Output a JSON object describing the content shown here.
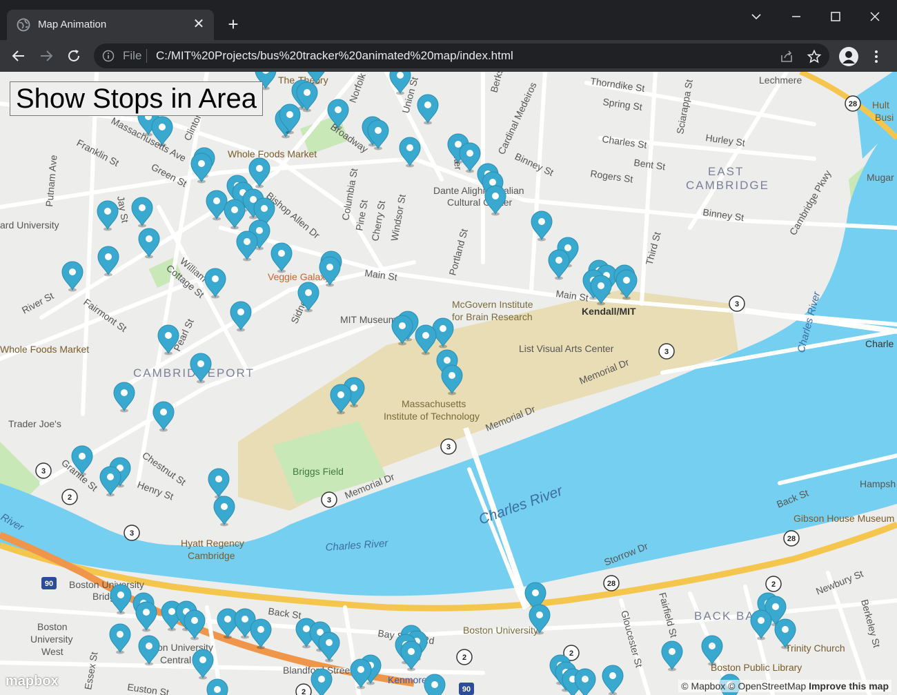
{
  "browser": {
    "tab_title": "Map Animation",
    "address_scheme": "File",
    "address_url": "C:/MIT%20Projects/bus%20tracker%20animated%20map/index.html"
  },
  "page": {
    "button_label": "Show Stops in Area"
  },
  "map": {
    "attribution_mapbox": "© Mapbox",
    "attribution_osm": "© OpenStreetMap",
    "attribution_improve": "Improve this map",
    "logo": "mapbox",
    "colors": {
      "water": "#75cff0",
      "land": "#ededeb",
      "campus": "#e8ddb5",
      "park": "#c9e8b8",
      "highway": "#f5c64d",
      "marker": "#3aa9cf"
    },
    "labels": {
      "lechmere": "Lechmere",
      "thorndike": "Thorndike St",
      "spring": "Spring St",
      "charles_st": "Charles St",
      "hurley": "Hurley St",
      "bent": "Bent St",
      "rogers": "Rogers St",
      "east_cambridge_1": "EAST",
      "east_cambridge_2": "CAMBRIDGE",
      "binney": "Binney St",
      "binney2": "Binney St",
      "whole_foods_1": "Whole Foods Market",
      "whole_foods_2": "Whole Foods Market",
      "franklin": "Franklin St",
      "green": "Green St",
      "putnam": "Putnam Ave",
      "harvard_univ": "ard University",
      "dante_1": "Dante Alighieri Italian",
      "dante_2": "Cultural Center",
      "main_st_1": "Main St",
      "main_st_2": "Main St",
      "kendall": "Kendall/MIT",
      "mcgovern_1": "McGovern Institute",
      "mcgovern_2": "for Brain Research",
      "mit_museum": "MIT Museum",
      "list_visual": "List Visual Arts Center",
      "veggie": "Veggie Galaxy",
      "river_st": "River St",
      "fairmont": "Fairmont St",
      "cambridgeport": "CAMBRIDGEPORT",
      "trader_joes": "Trader Joe's",
      "mit_1": "Massachusetts",
      "mit_2": "Institute of Technology",
      "memorial_1": "Memorial Dr",
      "memorial_2": "Memorial Dr",
      "memorial_3": "Memorial Dr",
      "briggs": "Briggs Field",
      "charles_river_1": "Charles River",
      "charles_river_2": "Charles River",
      "charles_river_3": "Charles River",
      "hyatt_1": "Hyatt Regency",
      "hyatt_2": "Cambridge",
      "storrow": "Storrow Dr",
      "back_st": "Back St",
      "back_st_2": "Back St",
      "gibson": "Gibson House Museum",
      "bu_bridge_1": "Boston University",
      "bu_bridge_2": "Bridge",
      "bu_west_1": "Boston",
      "bu_west_2": "University",
      "bu_west_3": "West",
      "bu_central_1": "on University",
      "bu_central_2": "Central",
      "boston_univ": "Boston University",
      "blandford": "Blandford Street",
      "kenmore": "Kenmore",
      "bay_state": "Bay State Rd",
      "newbury": "Newbury St",
      "back_bay": "BACK BAY",
      "trinity": "Trinity Church",
      "bpl": "Boston Public Library",
      "fairfield": "Fairfield St",
      "gloucester": "Gloucester St",
      "berkeley": "Berkeley St",
      "cambridge_pkwy": "Cambridge Pkwy",
      "third_st": "Third St",
      "portland": "Portland St",
      "windsor": "Windsor St",
      "columbia": "Columbia St",
      "broadway": "Broadway",
      "cardinal": "Cardinal Medeiros",
      "charles_right": "Charle",
      "hampshire": "Hampsh",
      "mugar": "Mugar",
      "hult_1": "Hult",
      "hult_2": "Busi",
      "sciarappa": "Sciarappa St",
      "river_left": "River",
      "william": "William St",
      "cottage": "Cottage St",
      "chestnut": "Chestnut St",
      "henry": "Henry St",
      "granite": "Granite St",
      "pearl": "Pearl St",
      "sidney": "Sidney St",
      "bishop": "Bishop Allen Dr",
      "webster": "Webster",
      "union": "Union St",
      "pine": "Pine St",
      "cherry": "Cherry St",
      "mass_ave": "Massachusetts Ave",
      "essex": "Essex St",
      "euston": "Euston St",
      "theory_1": "The",
      "theory_2": "Theory",
      "norfolk": "Norfolk St",
      "clinton": "Clinton St",
      "jay": "Jay St",
      "berks": "Berks"
    },
    "route_shields": [
      "28",
      "3",
      "3",
      "3",
      "3",
      "3",
      "3",
      "2",
      "28",
      "2",
      "28",
      "90",
      "90",
      "2",
      "2",
      "2"
    ]
  }
}
